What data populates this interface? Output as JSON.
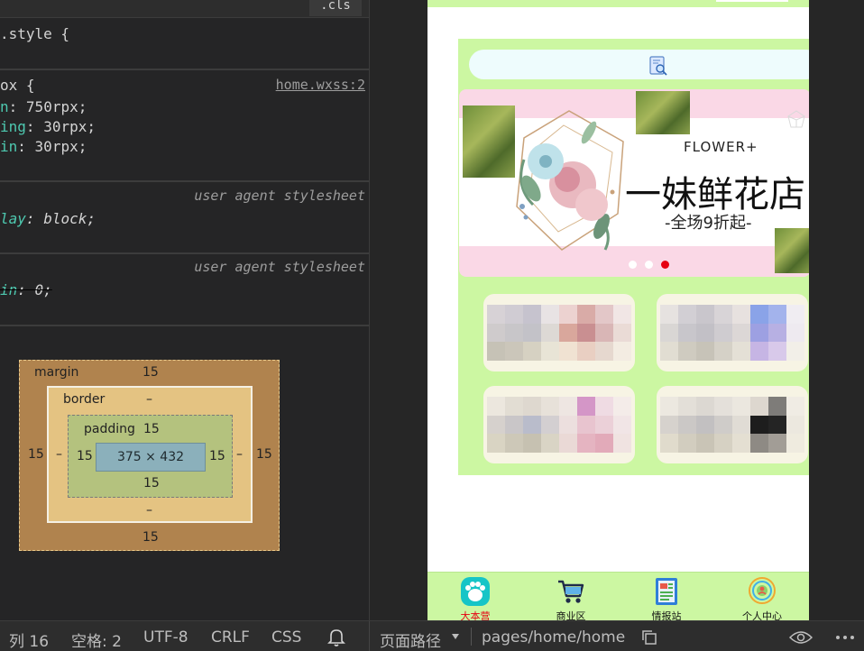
{
  "devtools": {
    "cls_label": ".cls",
    "style_rule": {
      "selector": ".style {"
    },
    "box_rule": {
      "selector_tail": "ox {",
      "source": "home.wxss:2",
      "props": [
        {
          "name": "n",
          "sep": ":",
          "value": "750rpx;"
        },
        {
          "name": "ing",
          "sep": ":",
          "value": "30rpx;"
        },
        {
          "name": "in",
          "sep": ":",
          "value": "30rpx;"
        }
      ]
    },
    "ua_rule1": {
      "source": "user agent stylesheet",
      "prop": "lay",
      "value": "block;"
    },
    "ua_rule2": {
      "source": "user agent stylesheet",
      "prop": "in",
      "value": "0;"
    },
    "box_model": {
      "margin_label": "margin",
      "margin_top": "15",
      "margin_bottom": "15",
      "margin_left": "15",
      "margin_right": "15",
      "border_label": "border",
      "border_top": "–",
      "border_bottom": "–",
      "border_left": "–",
      "border_right": "–",
      "padding_label": "padding",
      "padding_top": "15",
      "padding_bottom": "15",
      "padding_left": "15",
      "padding_right": "15",
      "content_size": "375 × 432"
    }
  },
  "phone": {
    "banner": {
      "subtitle": "FLOWER+",
      "title": "一妹鲜花店",
      "tagline": "-全场9折起-",
      "slide_count": 3,
      "active_slide": 3
    },
    "tabs": [
      {
        "label": "大本营",
        "icon": "paw-icon",
        "active": true
      },
      {
        "label": "商业区",
        "icon": "cart-icon",
        "active": false
      },
      {
        "label": "情报站",
        "icon": "news-icon",
        "active": false
      },
      {
        "label": "个人中心",
        "icon": "profile-icon",
        "active": false
      }
    ],
    "colors": {
      "theme_green": "#ccf7a2",
      "active_red": "#e60012",
      "banner_pink": "#fad8e6"
    }
  },
  "statusbar": {
    "line_col": "列 16",
    "spaces": "空格: 2",
    "encoding": "UTF-8",
    "eol": "CRLF",
    "language": "CSS",
    "page_path_label": "页面路径",
    "page_path": "pages/home/home"
  }
}
